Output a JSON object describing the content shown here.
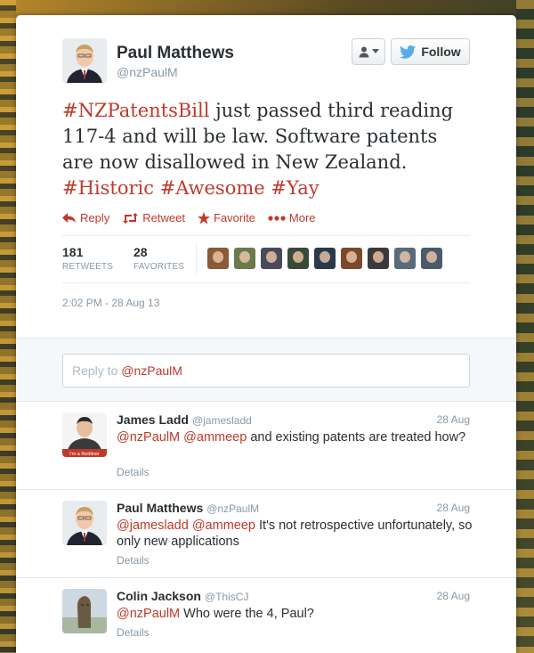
{
  "tweet": {
    "author_name": "Paul Matthews",
    "author_handle": "@nzPaulM",
    "follow_label": "Follow",
    "text_parts": [
      {
        "text": "#NZPatentsBill",
        "hashtag": true
      },
      {
        "text": " just passed third reading 117-4 and will be law. Software patents are now disallowed in New Zealand. ",
        "hashtag": false
      },
      {
        "text": "#Historic",
        "hashtag": true
      },
      {
        "text": " ",
        "hashtag": false
      },
      {
        "text": "#Awesome",
        "hashtag": true
      },
      {
        "text": " ",
        "hashtag": false
      },
      {
        "text": "#Yay",
        "hashtag": true
      }
    ],
    "actions": {
      "reply": "Reply",
      "retweet": "Retweet",
      "favorite": "Favorite",
      "more": "More"
    },
    "stats": {
      "retweets_count": "181",
      "retweets_label": "RETWEETS",
      "favorites_count": "28",
      "favorites_label": "FAVORITES"
    },
    "favoriter_avatar_colors": [
      "#8a5a3a",
      "#6a7a4a",
      "#4a4a5a",
      "#3a4a3a",
      "#2a3a4a",
      "#7a4a2a",
      "#3a3a3a",
      "#5a6a7a",
      "#4a5a6a"
    ],
    "timestamp": "2:02 PM - 28 Aug 13"
  },
  "reply_box": {
    "prefix": "Reply to ",
    "mention": "@nzPaulM"
  },
  "replies": [
    {
      "name": "James Ladd",
      "handle": "@jamesladd",
      "date": "28 Aug",
      "mentions": "@nzPaulM @ammeep",
      "text": " and existing patents are treated how?",
      "details": "Details",
      "avatar_badge": "I'm a Redliner"
    },
    {
      "name": "Paul Matthews",
      "handle": "@nzPaulM",
      "date": "28 Aug",
      "mentions": "@jamesladd @ammeep",
      "text": " It's not retrospective unfortunately, so only new applications",
      "details": "Details"
    },
    {
      "name": "Colin Jackson",
      "handle": "@ThisCJ",
      "date": "28 Aug",
      "mentions": "@nzPaulM",
      "text": " Who were the 4, Paul?",
      "details": "Details"
    }
  ],
  "colors": {
    "accent": "#c0392b",
    "twitter_blue": "#55acee",
    "muted": "#8899a6"
  }
}
